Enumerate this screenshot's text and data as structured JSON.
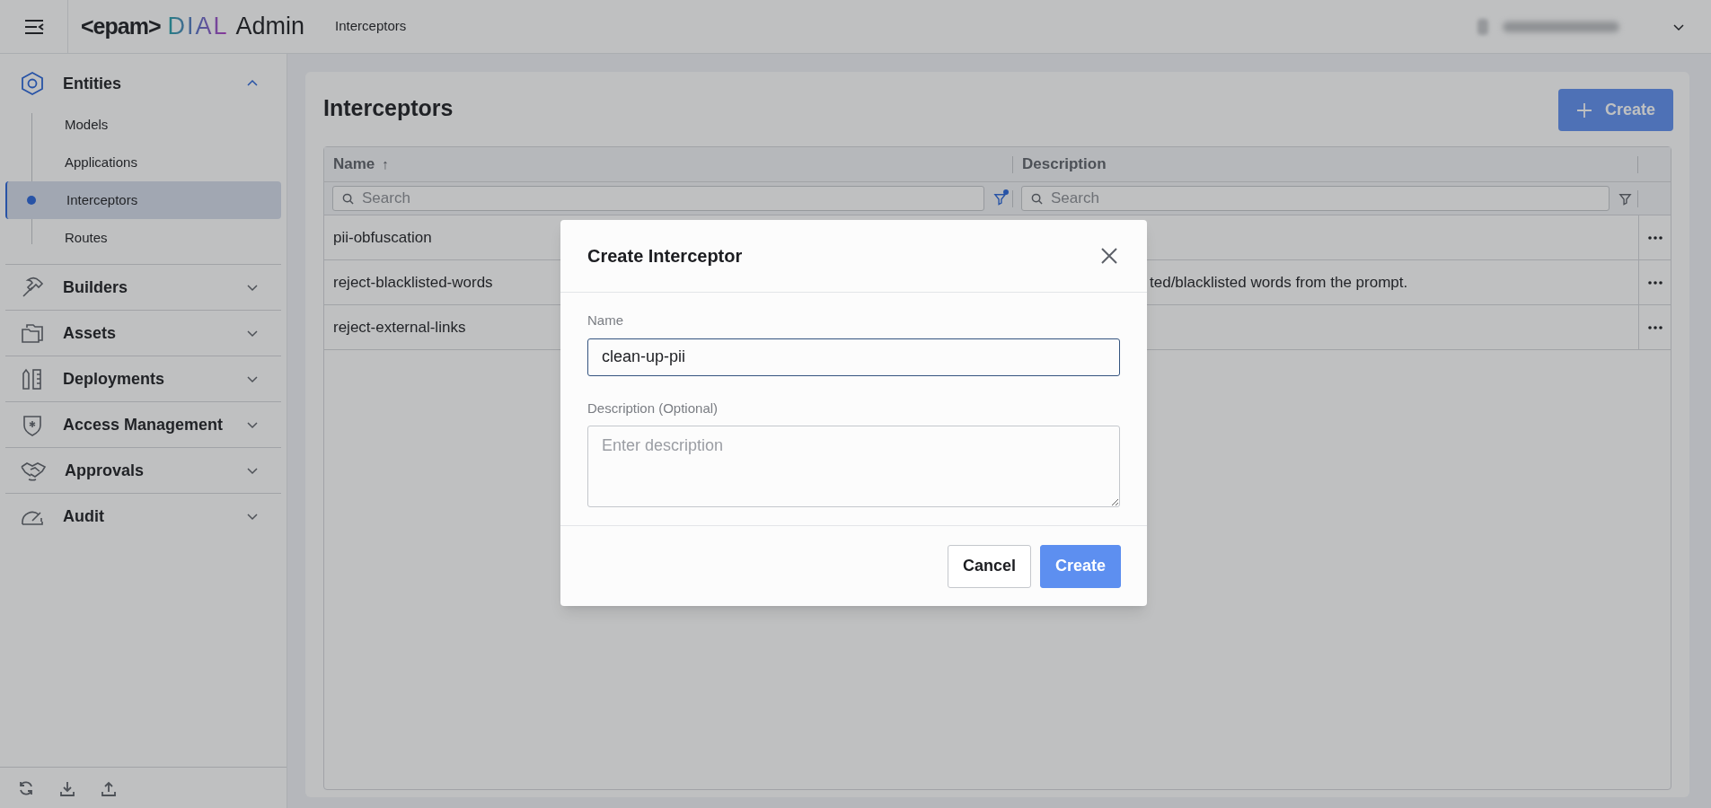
{
  "header": {
    "logo": {
      "brand": "<epam>",
      "product": "DIAL",
      "suffix": "Admin"
    },
    "breadcrumb": "Interceptors"
  },
  "sidebar": {
    "groups": [
      {
        "label": "Entities",
        "expanded": true,
        "children": [
          {
            "label": "Models",
            "selected": false
          },
          {
            "label": "Applications",
            "selected": false
          },
          {
            "label": "Interceptors",
            "selected": true
          },
          {
            "label": "Routes",
            "selected": false
          }
        ]
      },
      {
        "label": "Builders",
        "expanded": false
      },
      {
        "label": "Assets",
        "expanded": false
      },
      {
        "label": "Deployments",
        "expanded": false
      },
      {
        "label": "Access Management",
        "expanded": false
      },
      {
        "label": "Approvals",
        "expanded": false
      },
      {
        "label": "Audit",
        "expanded": false
      }
    ]
  },
  "page": {
    "title": "Interceptors",
    "create_button": "Create"
  },
  "table": {
    "columns": [
      {
        "label": "Name",
        "sort_arrow": "↑",
        "filter_active": true,
        "filter_placeholder": "Search"
      },
      {
        "label": "Description",
        "filter_active": false,
        "filter_placeholder": "Search"
      }
    ],
    "rows": [
      {
        "name": "pii-obfuscation"
      },
      {
        "name": "reject-blacklisted-words",
        "description": "ted/blacklisted words from the prompt."
      },
      {
        "name": "reject-external-links"
      }
    ]
  },
  "modal": {
    "title": "Create Interceptor",
    "fields": [
      {
        "kind": "input",
        "label": "Name",
        "value": "clean-up-pii",
        "focused": true
      },
      {
        "kind": "textarea",
        "label": "Description (Optional)",
        "placeholder": "Enter description",
        "focused": false
      }
    ],
    "buttons": [
      {
        "kind": "secondary",
        "label": "Cancel"
      },
      {
        "kind": "primary",
        "label": "Create"
      }
    ]
  }
}
